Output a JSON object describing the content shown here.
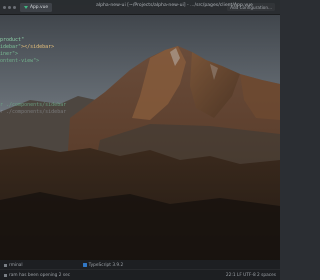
{
  "window": {
    "tab_label": "App.vue",
    "title_path": "alpha-new-ui [~/Projects/alpha-new-ui] - .../src/pages/client/App.vue",
    "run_config_label": "Add Configuration..."
  },
  "editor": {
    "line1": "product\"",
    "line2_a": "idebar\"",
    "line2_b": "></sidebar>",
    "line3": "iner\">",
    "line4": "ontent-view\">",
    "line5": "r ./components/sidebar",
    "line6": "r ./components/sidebar"
  },
  "statusbar": {
    "tool_window_label": "rminal",
    "typescript_label": "TypeScript 3.9.2",
    "event_log_text": "ram has been opening 2 sec",
    "position_text": "22:1  LF  UTF-8  2 spaces"
  },
  "colors": {
    "sky": "#8d959c",
    "code_accent": "#7fc39a",
    "typescript_badge": "#3178c6"
  }
}
